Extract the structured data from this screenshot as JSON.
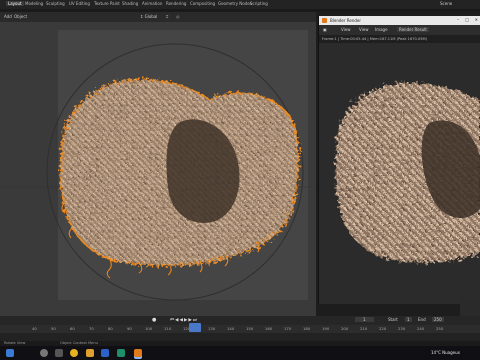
{
  "topbar": {
    "workspaces": [
      "Layout",
      "Modeling",
      "Sculpting",
      "UV Editing",
      "Texture Paint",
      "Shading",
      "Animation",
      "Rendering",
      "Compositing",
      "Geometry Nodes",
      "Scripting"
    ],
    "active_workspace": "Layout",
    "scene_label": "Scene"
  },
  "viewport_header": {
    "add": "Add",
    "object": "Object",
    "orientation": "Global"
  },
  "render_window": {
    "title": "Blender Render",
    "menu": {
      "view": "View",
      "view_label": "View",
      "image": "Image",
      "slot": "Render Result"
    },
    "info": "Frame:1 | Time:00:05.44 | Mem:167.11M (Peak 1670.05M)"
  },
  "timeline": {
    "ticks": [
      "40",
      "50",
      "60",
      "70",
      "80",
      "90",
      "100",
      "110",
      "120",
      "130",
      "140",
      "150",
      "160",
      "170",
      "180",
      "190",
      "200",
      "210",
      "220",
      "230",
      "240",
      "250"
    ],
    "current_frame": "1",
    "start_label": "Start",
    "start_value": "1",
    "end_label": "End",
    "end_value": "250"
  },
  "statusbar": {
    "left": "Rotate View",
    "center": "Object Context Menu"
  },
  "taskbar": {
    "weather": "14°C  Nuageux",
    "time": "",
    "date": ""
  },
  "colors": {
    "selection_outline": "#f08a1c",
    "hair": "#b79a7f",
    "playhead": "#4a78c9"
  }
}
